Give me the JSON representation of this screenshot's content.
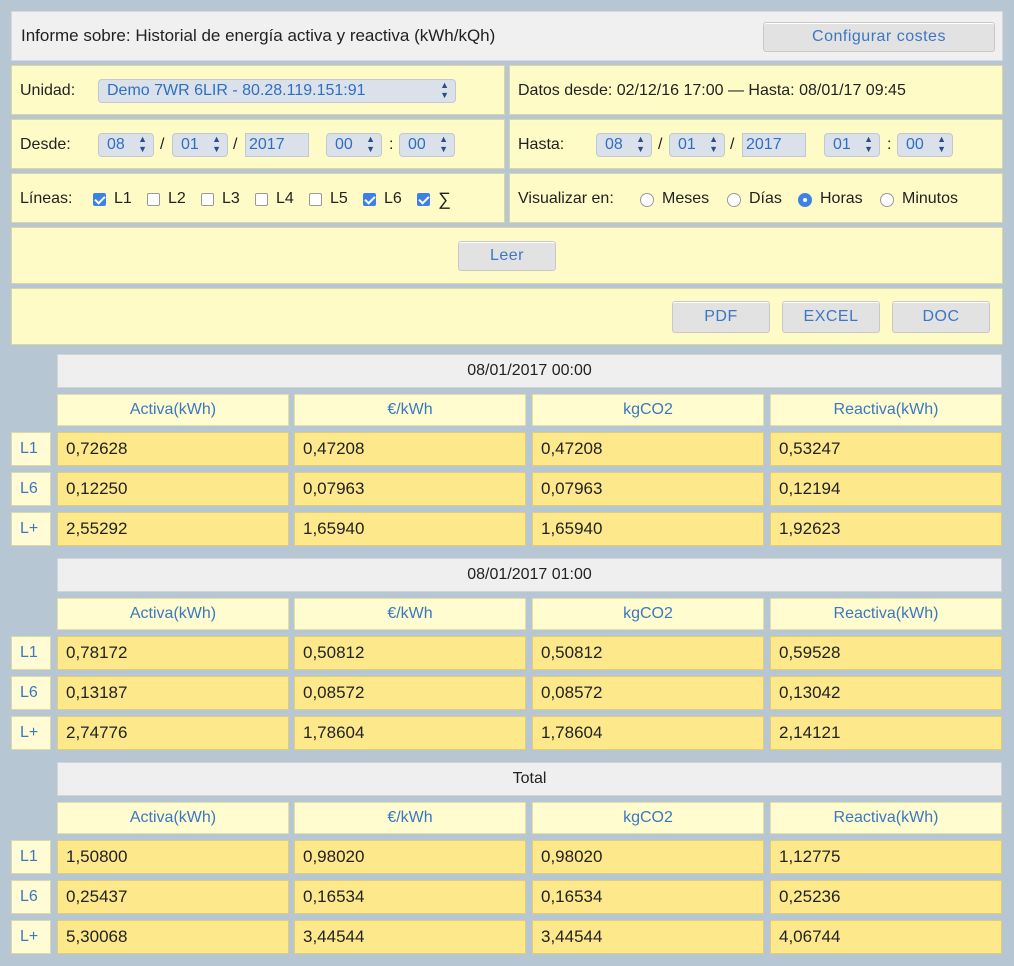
{
  "header": {
    "title": "Informe sobre: Historial de energía activa y reactiva (kWh/kQh)",
    "config_button": "Configurar costes"
  },
  "unit": {
    "label": "Unidad:",
    "value": "Demo 7WR 6LIR - 80.28.119.151:91"
  },
  "data_range": "Datos desde: 02/12/16 17:00 — Hasta: 08/01/17 09:45",
  "from": {
    "label": "Desde:",
    "day": "08",
    "month": "01",
    "year": "2017",
    "hour": "00",
    "minute": "00"
  },
  "to": {
    "label": "Hasta:",
    "day": "08",
    "month": "01",
    "year": "2017",
    "hour": "01",
    "minute": "00"
  },
  "lines": {
    "label": "Líneas:",
    "items": [
      {
        "label": "L1",
        "checked": true
      },
      {
        "label": "L2",
        "checked": false
      },
      {
        "label": "L3",
        "checked": false
      },
      {
        "label": "L4",
        "checked": false
      },
      {
        "label": "L5",
        "checked": false
      },
      {
        "label": "L6",
        "checked": true
      },
      {
        "label": "∑",
        "checked": true
      }
    ]
  },
  "view": {
    "label": "Visualizar en:",
    "options": [
      {
        "label": "Meses",
        "selected": false
      },
      {
        "label": "Días",
        "selected": false
      },
      {
        "label": "Horas",
        "selected": true
      },
      {
        "label": "Minutos",
        "selected": false
      }
    ]
  },
  "read_button": "Leer",
  "export": {
    "pdf": "PDF",
    "excel": "EXCEL",
    "doc": "DOC"
  },
  "columns": [
    "Activa(kWh)",
    "€/kWh",
    "kgCO2",
    "Reactiva(kWh)"
  ],
  "sections": [
    {
      "title": "08/01/2017 00:00",
      "rows": [
        {
          "line": "L1",
          "values": [
            "0,72628",
            "0,47208",
            "0,47208",
            "0,53247"
          ]
        },
        {
          "line": "L6",
          "values": [
            "0,12250",
            "0,07963",
            "0,07963",
            "0,12194"
          ]
        },
        {
          "line": "L+",
          "values": [
            "2,55292",
            "1,65940",
            "1,65940",
            "1,92623"
          ]
        }
      ]
    },
    {
      "title": "08/01/2017 01:00",
      "rows": [
        {
          "line": "L1",
          "values": [
            "0,78172",
            "0,50812",
            "0,50812",
            "0,59528"
          ]
        },
        {
          "line": "L6",
          "values": [
            "0,13187",
            "0,08572",
            "0,08572",
            "0,13042"
          ]
        },
        {
          "line": "L+",
          "values": [
            "2,74776",
            "1,78604",
            "1,78604",
            "2,14121"
          ]
        }
      ]
    },
    {
      "title": "Total",
      "rows": [
        {
          "line": "L1",
          "values": [
            "1,50800",
            "0,98020",
            "0,98020",
            "1,12775"
          ]
        },
        {
          "line": "L6",
          "values": [
            "0,25437",
            "0,16534",
            "0,16534",
            "0,25236"
          ]
        },
        {
          "line": "L+",
          "values": [
            "5,30068",
            "3,44544",
            "3,44544",
            "4,06744"
          ]
        }
      ]
    }
  ]
}
